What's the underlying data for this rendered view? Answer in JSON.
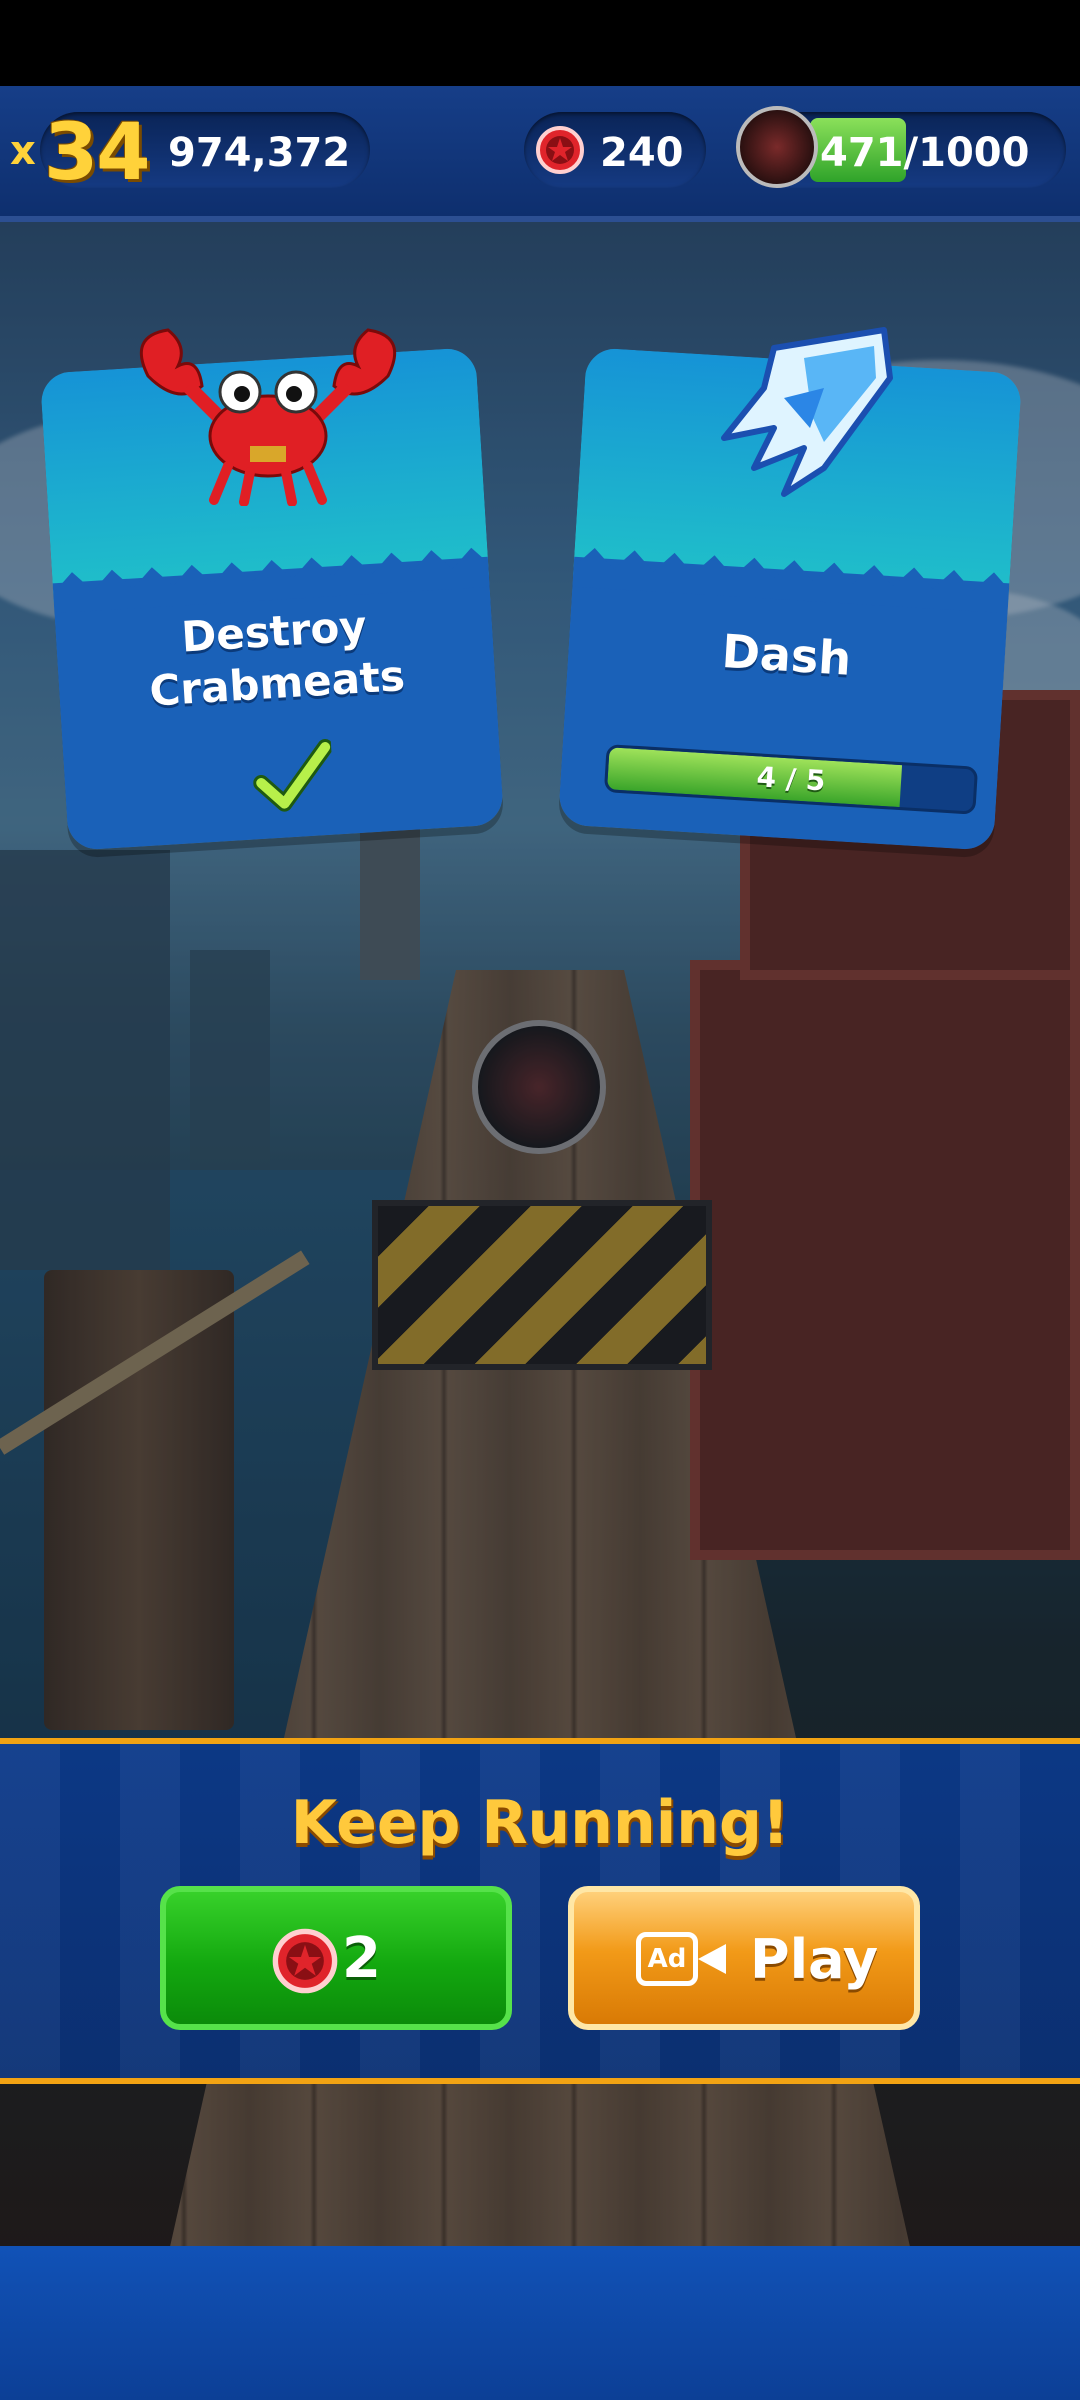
{
  "hud": {
    "multiplier_prefix": "x",
    "multiplier_value": "34",
    "score": "974,372",
    "rings": "240",
    "tokens": "471/1000",
    "tokens_progress": 0.471
  },
  "missions": [
    {
      "title_line1": "Destroy",
      "title_line2": "Crabmeats",
      "icon": "crabmeat-icon",
      "status": "completed",
      "check_icon": "checkmark-icon"
    },
    {
      "title": "Dash",
      "icon": "dash-crystal-icon",
      "progress_text": "4 / 5",
      "progress": 0.8
    }
  ],
  "continue_panel": {
    "title": "Keep Running!",
    "ring_cost": "2",
    "ad_badge": "Ad",
    "ad_button_label": "Play"
  },
  "colors": {
    "hud_blue": "#0e2f6e",
    "gold": "#ffc93c",
    "green_button": "#13a80f",
    "orange_button": "#f29a18",
    "ring_red": "#e0242b"
  }
}
